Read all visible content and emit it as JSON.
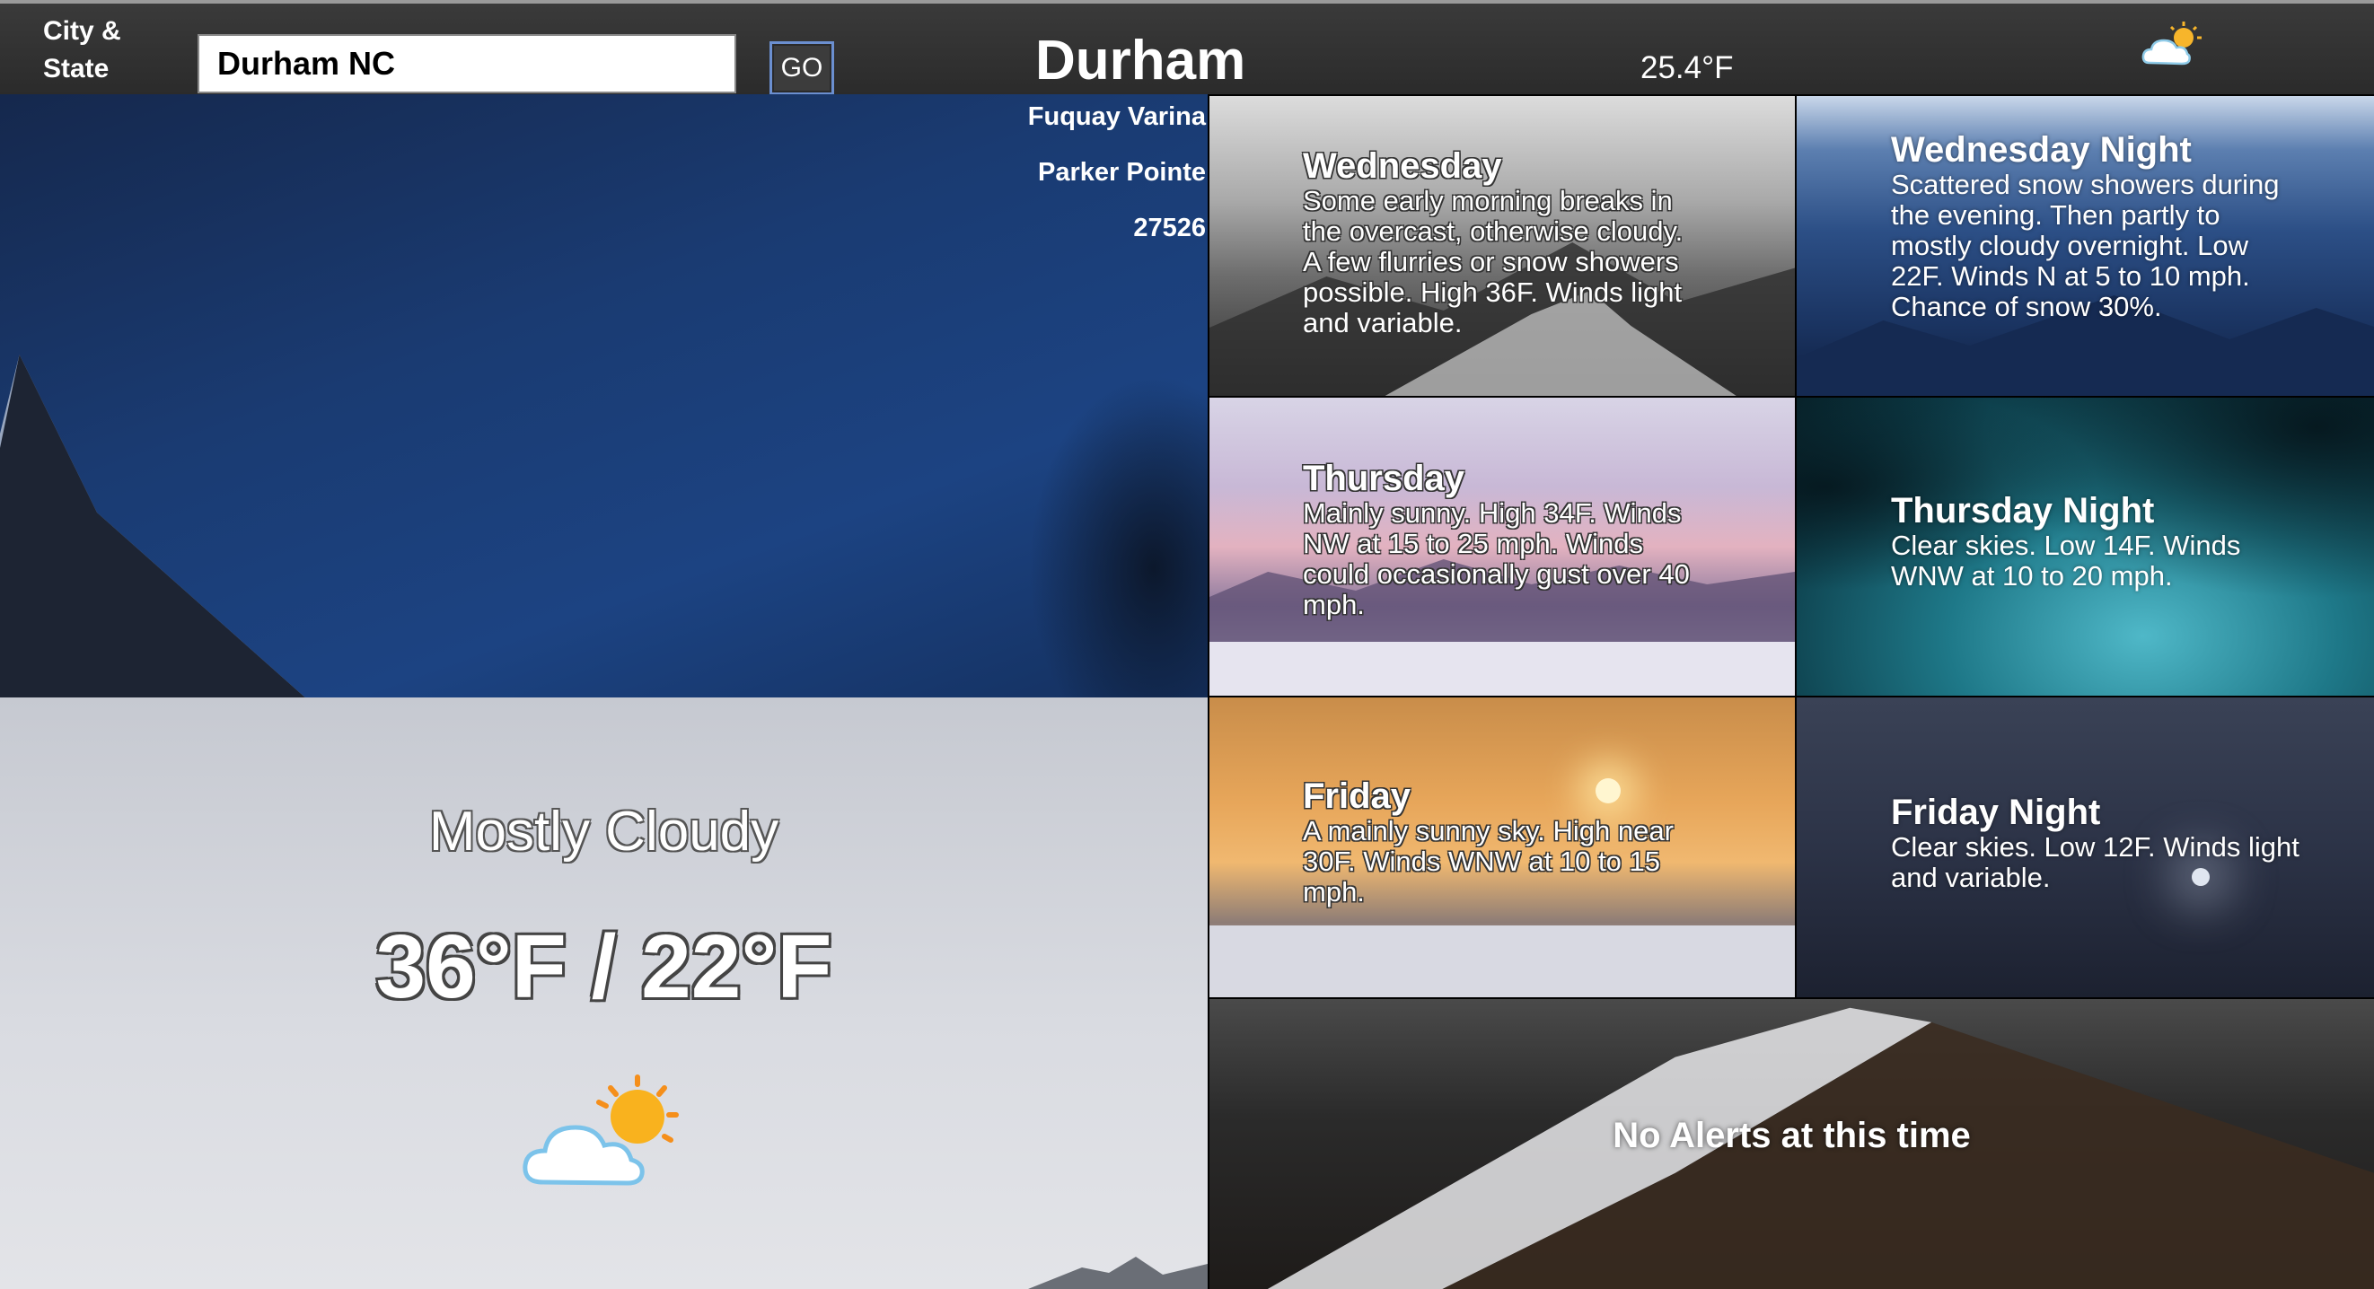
{
  "header": {
    "city_label": "City & State",
    "search_value": "Durham NC",
    "go_label": "GO",
    "city": "Durham",
    "temperature": "25.4°F",
    "weather_icon": "partly-cloudy-icon"
  },
  "nearby": [
    "Fuquay Varina",
    "Parker Pointe",
    "27526"
  ],
  "current": {
    "condition": "Mostly Cloudy",
    "hi_lo": "36°F / 22°F",
    "weather_icon": "partly-cloudy-icon"
  },
  "forecast": [
    {
      "title": "Wednesday",
      "text": "Some early morning breaks in the overcast, otherwise cloudy. A few flurries or snow showers possible. High 36F. Winds light and variable."
    },
    {
      "title": "Wednesday Night",
      "text": "Scattered snow showers during the evening. Then partly to mostly cloudy overnight. Low 22F. Winds N at 5 to 10 mph. Chance of snow 30%."
    },
    {
      "title": "Thursday",
      "text": "Mainly sunny. High 34F. Winds NW at 15 to 25 mph. Winds could occasionally gust over 40 mph."
    },
    {
      "title": "Thursday Night",
      "text": "Clear skies. Low 14F. Winds WNW at 10 to 20 mph."
    },
    {
      "title": "Friday",
      "text": "A mainly sunny sky. High near 30F. Winds WNW at 10 to 15 mph."
    },
    {
      "title": "Friday Night",
      "text": "Clear skies. Low 12F. Winds light and variable."
    }
  ],
  "alerts": {
    "text": "No Alerts at this time"
  }
}
